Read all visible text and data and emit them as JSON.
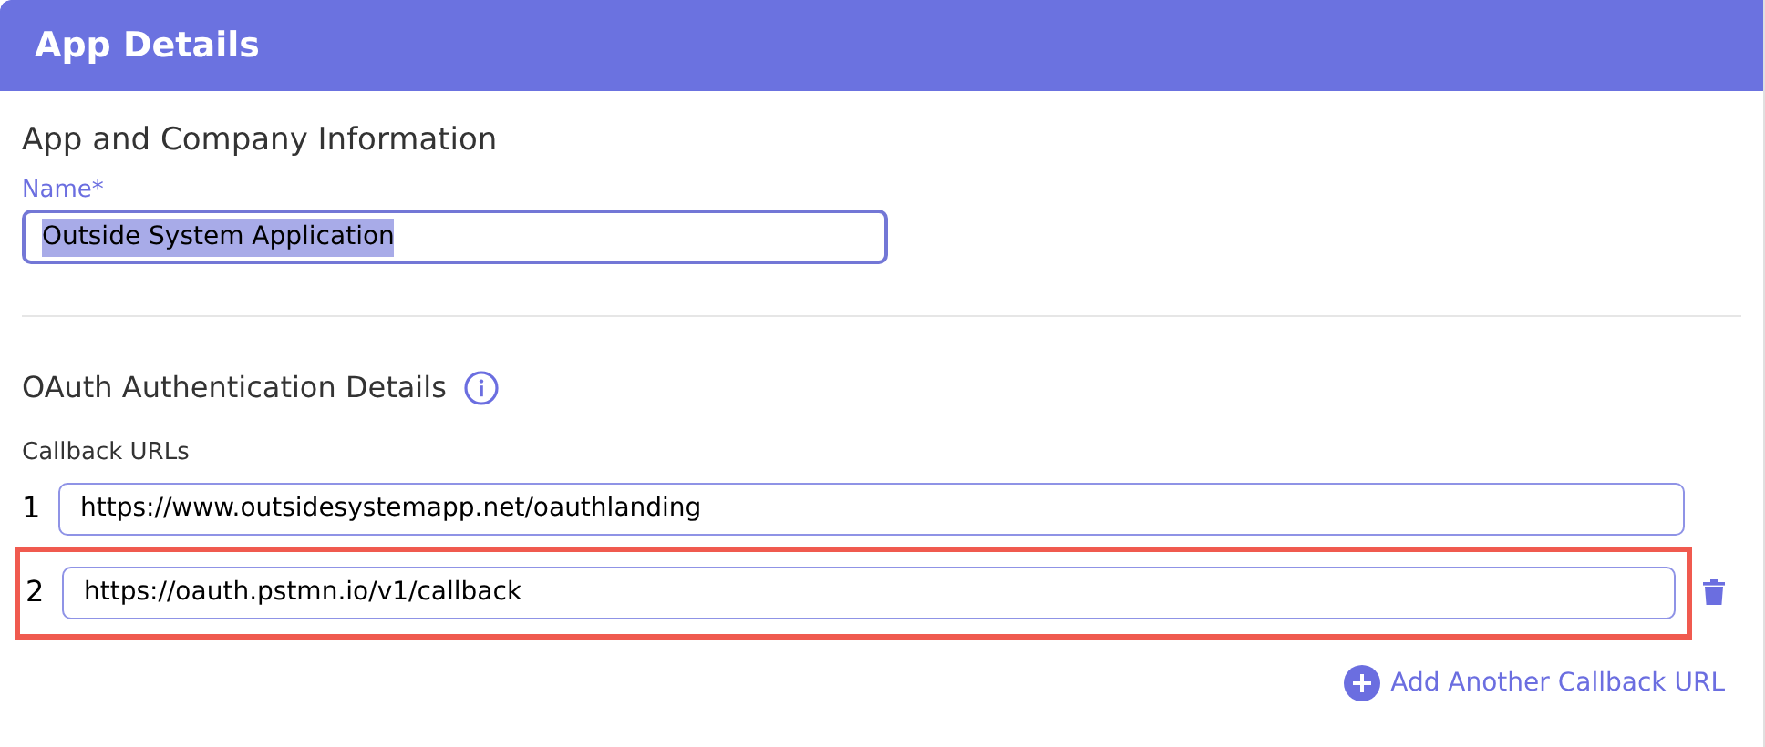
{
  "header": {
    "title": "App Details"
  },
  "company_section": {
    "title": "App and Company Information",
    "name_field": {
      "label": "Name*",
      "value": "Outside System Application",
      "focused": true,
      "text_selected": true
    }
  },
  "oauth_section": {
    "title": "OAuth Authentication Details",
    "callback_label": "Callback URLs",
    "callback_urls": [
      {
        "number": "1",
        "value": "https://www.outsidesystemapp.net/oauthlanding",
        "highlighted": false,
        "removable": false
      },
      {
        "number": "2",
        "value": "https://oauth.pstmn.io/v1/callback",
        "highlighted": true,
        "removable": true
      }
    ],
    "add_link": "Add Another Callback URL"
  }
}
